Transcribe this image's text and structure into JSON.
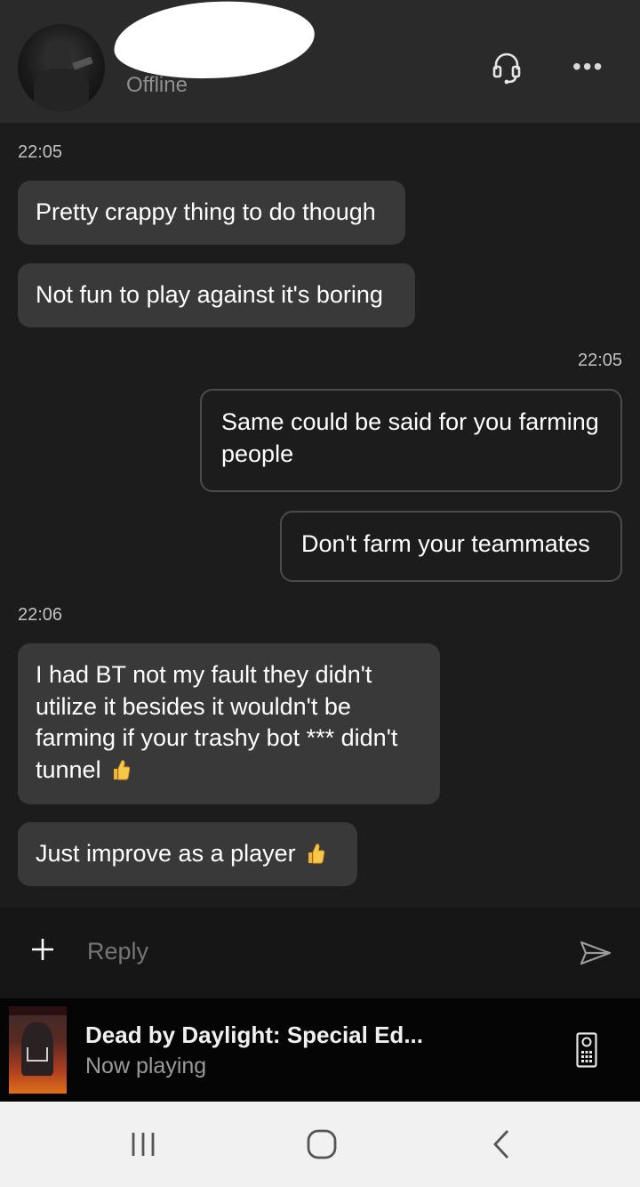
{
  "header": {
    "status": "Offline",
    "icons": {
      "avatar": "profile-picture",
      "voice": "headset-icon",
      "more": "more-options-icon"
    },
    "more_glyph": "•••"
  },
  "chat": {
    "groups": [
      {
        "timestamp": "22:05",
        "side": "incoming",
        "messages": [
          "Pretty crappy thing to do though",
          "Not fun to play against it's boring"
        ]
      },
      {
        "timestamp": "22:05",
        "side": "outgoing",
        "messages": [
          "Same could be said for you farming people",
          "Don't farm your teammates"
        ]
      },
      {
        "timestamp": "22:06",
        "side": "incoming",
        "messages": [
          "I had BT not my fault they didn't utilize it besides it wouldn't be farming if your trashy bot *** didn't tunnel",
          "Just improve as a player"
        ]
      }
    ],
    "emoji": "thumbs-up-emoji"
  },
  "reply": {
    "placeholder": "Reply",
    "icons": {
      "attach": "plus-icon",
      "send": "send-icon"
    }
  },
  "now_playing": {
    "title": "Dead by Daylight: Special Ed...",
    "subtitle": "Now playing",
    "icons": {
      "art": "game-box-art",
      "remote": "remote-icon"
    }
  },
  "android_nav": {
    "icons": [
      "recent-apps-icon",
      "home-icon",
      "back-icon"
    ]
  },
  "colors": {
    "header_bg": "#2a2a2a",
    "chat_bg": "#1c1c1c",
    "incoming_bubble": "#393939",
    "outgoing_border": "#4b4b4b",
    "now_playing_bg": "#050505",
    "nav_bg": "#f1f1f1"
  }
}
